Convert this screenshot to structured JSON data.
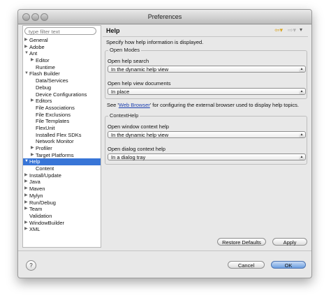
{
  "window": {
    "title": "Preferences"
  },
  "filter": {
    "placeholder": "type filter text"
  },
  "tree": [
    {
      "label": "General",
      "indent": 0,
      "arrow": "▶"
    },
    {
      "label": "Adobe",
      "indent": 0,
      "arrow": "▶"
    },
    {
      "label": "Ant",
      "indent": 0,
      "arrow": "▼"
    },
    {
      "label": "Editor",
      "indent": 1,
      "arrow": "▶"
    },
    {
      "label": "Runtime",
      "indent": 1,
      "arrow": ""
    },
    {
      "label": "Flash Builder",
      "indent": 0,
      "arrow": "▼"
    },
    {
      "label": "Data/Services",
      "indent": 1,
      "arrow": ""
    },
    {
      "label": "Debug",
      "indent": 1,
      "arrow": ""
    },
    {
      "label": "Device Configurations",
      "indent": 1,
      "arrow": ""
    },
    {
      "label": "Editors",
      "indent": 1,
      "arrow": "▶"
    },
    {
      "label": "File Associations",
      "indent": 1,
      "arrow": ""
    },
    {
      "label": "File Exclusions",
      "indent": 1,
      "arrow": ""
    },
    {
      "label": "File Templates",
      "indent": 1,
      "arrow": ""
    },
    {
      "label": "FlexUnit",
      "indent": 1,
      "arrow": ""
    },
    {
      "label": "Installed Flex SDKs",
      "indent": 1,
      "arrow": ""
    },
    {
      "label": "Network Monitor",
      "indent": 1,
      "arrow": ""
    },
    {
      "label": "Profiler",
      "indent": 1,
      "arrow": "▶"
    },
    {
      "label": "Target Platforms",
      "indent": 1,
      "arrow": "▶"
    },
    {
      "label": "Help",
      "indent": 0,
      "arrow": "▼",
      "selected": true
    },
    {
      "label": "Content",
      "indent": 1,
      "arrow": ""
    },
    {
      "label": "Install/Update",
      "indent": 0,
      "arrow": "▶"
    },
    {
      "label": "Java",
      "indent": 0,
      "arrow": "▶"
    },
    {
      "label": "Maven",
      "indent": 0,
      "arrow": "▶"
    },
    {
      "label": "Mylyn",
      "indent": 0,
      "arrow": "▶"
    },
    {
      "label": "Run/Debug",
      "indent": 0,
      "arrow": "▶"
    },
    {
      "label": "Team",
      "indent": 0,
      "arrow": "▶"
    },
    {
      "label": "Validation",
      "indent": 0,
      "arrow": ""
    },
    {
      "label": "WindowBuilder",
      "indent": 0,
      "arrow": "▶"
    },
    {
      "label": "XML",
      "indent": 0,
      "arrow": "▶"
    }
  ],
  "page": {
    "title": "Help",
    "description": "Specify how help information is displayed.",
    "open_modes": {
      "legend": "Open Modes",
      "search_label": "Open help search",
      "search_value": "In the dynamic help view",
      "docs_label": "Open help view documents",
      "docs_value": "In place"
    },
    "hint": {
      "prefix": "See '",
      "link": "Web Browser",
      "suffix": "' for configuring the external browser used to display help topics."
    },
    "context_help": {
      "legend": "ContextHelp",
      "window_label": "Open window context help",
      "window_value": "In the dynamic help view",
      "dialog_label": "Open dialog context help",
      "dialog_value": "In a dialog tray"
    },
    "restore_label": "Restore Defaults",
    "apply_label": "Apply"
  },
  "footer": {
    "help_glyph": "?",
    "cancel_label": "Cancel",
    "ok_label": "OK"
  },
  "colors": {
    "selection": "#3875d7",
    "link": "#1a3fb0",
    "default_button": "#6d9fe0"
  },
  "icons": {
    "back": "back-arrow-icon",
    "forward": "forward-arrow-icon",
    "menu": "view-menu-icon",
    "help": "help-icon"
  }
}
